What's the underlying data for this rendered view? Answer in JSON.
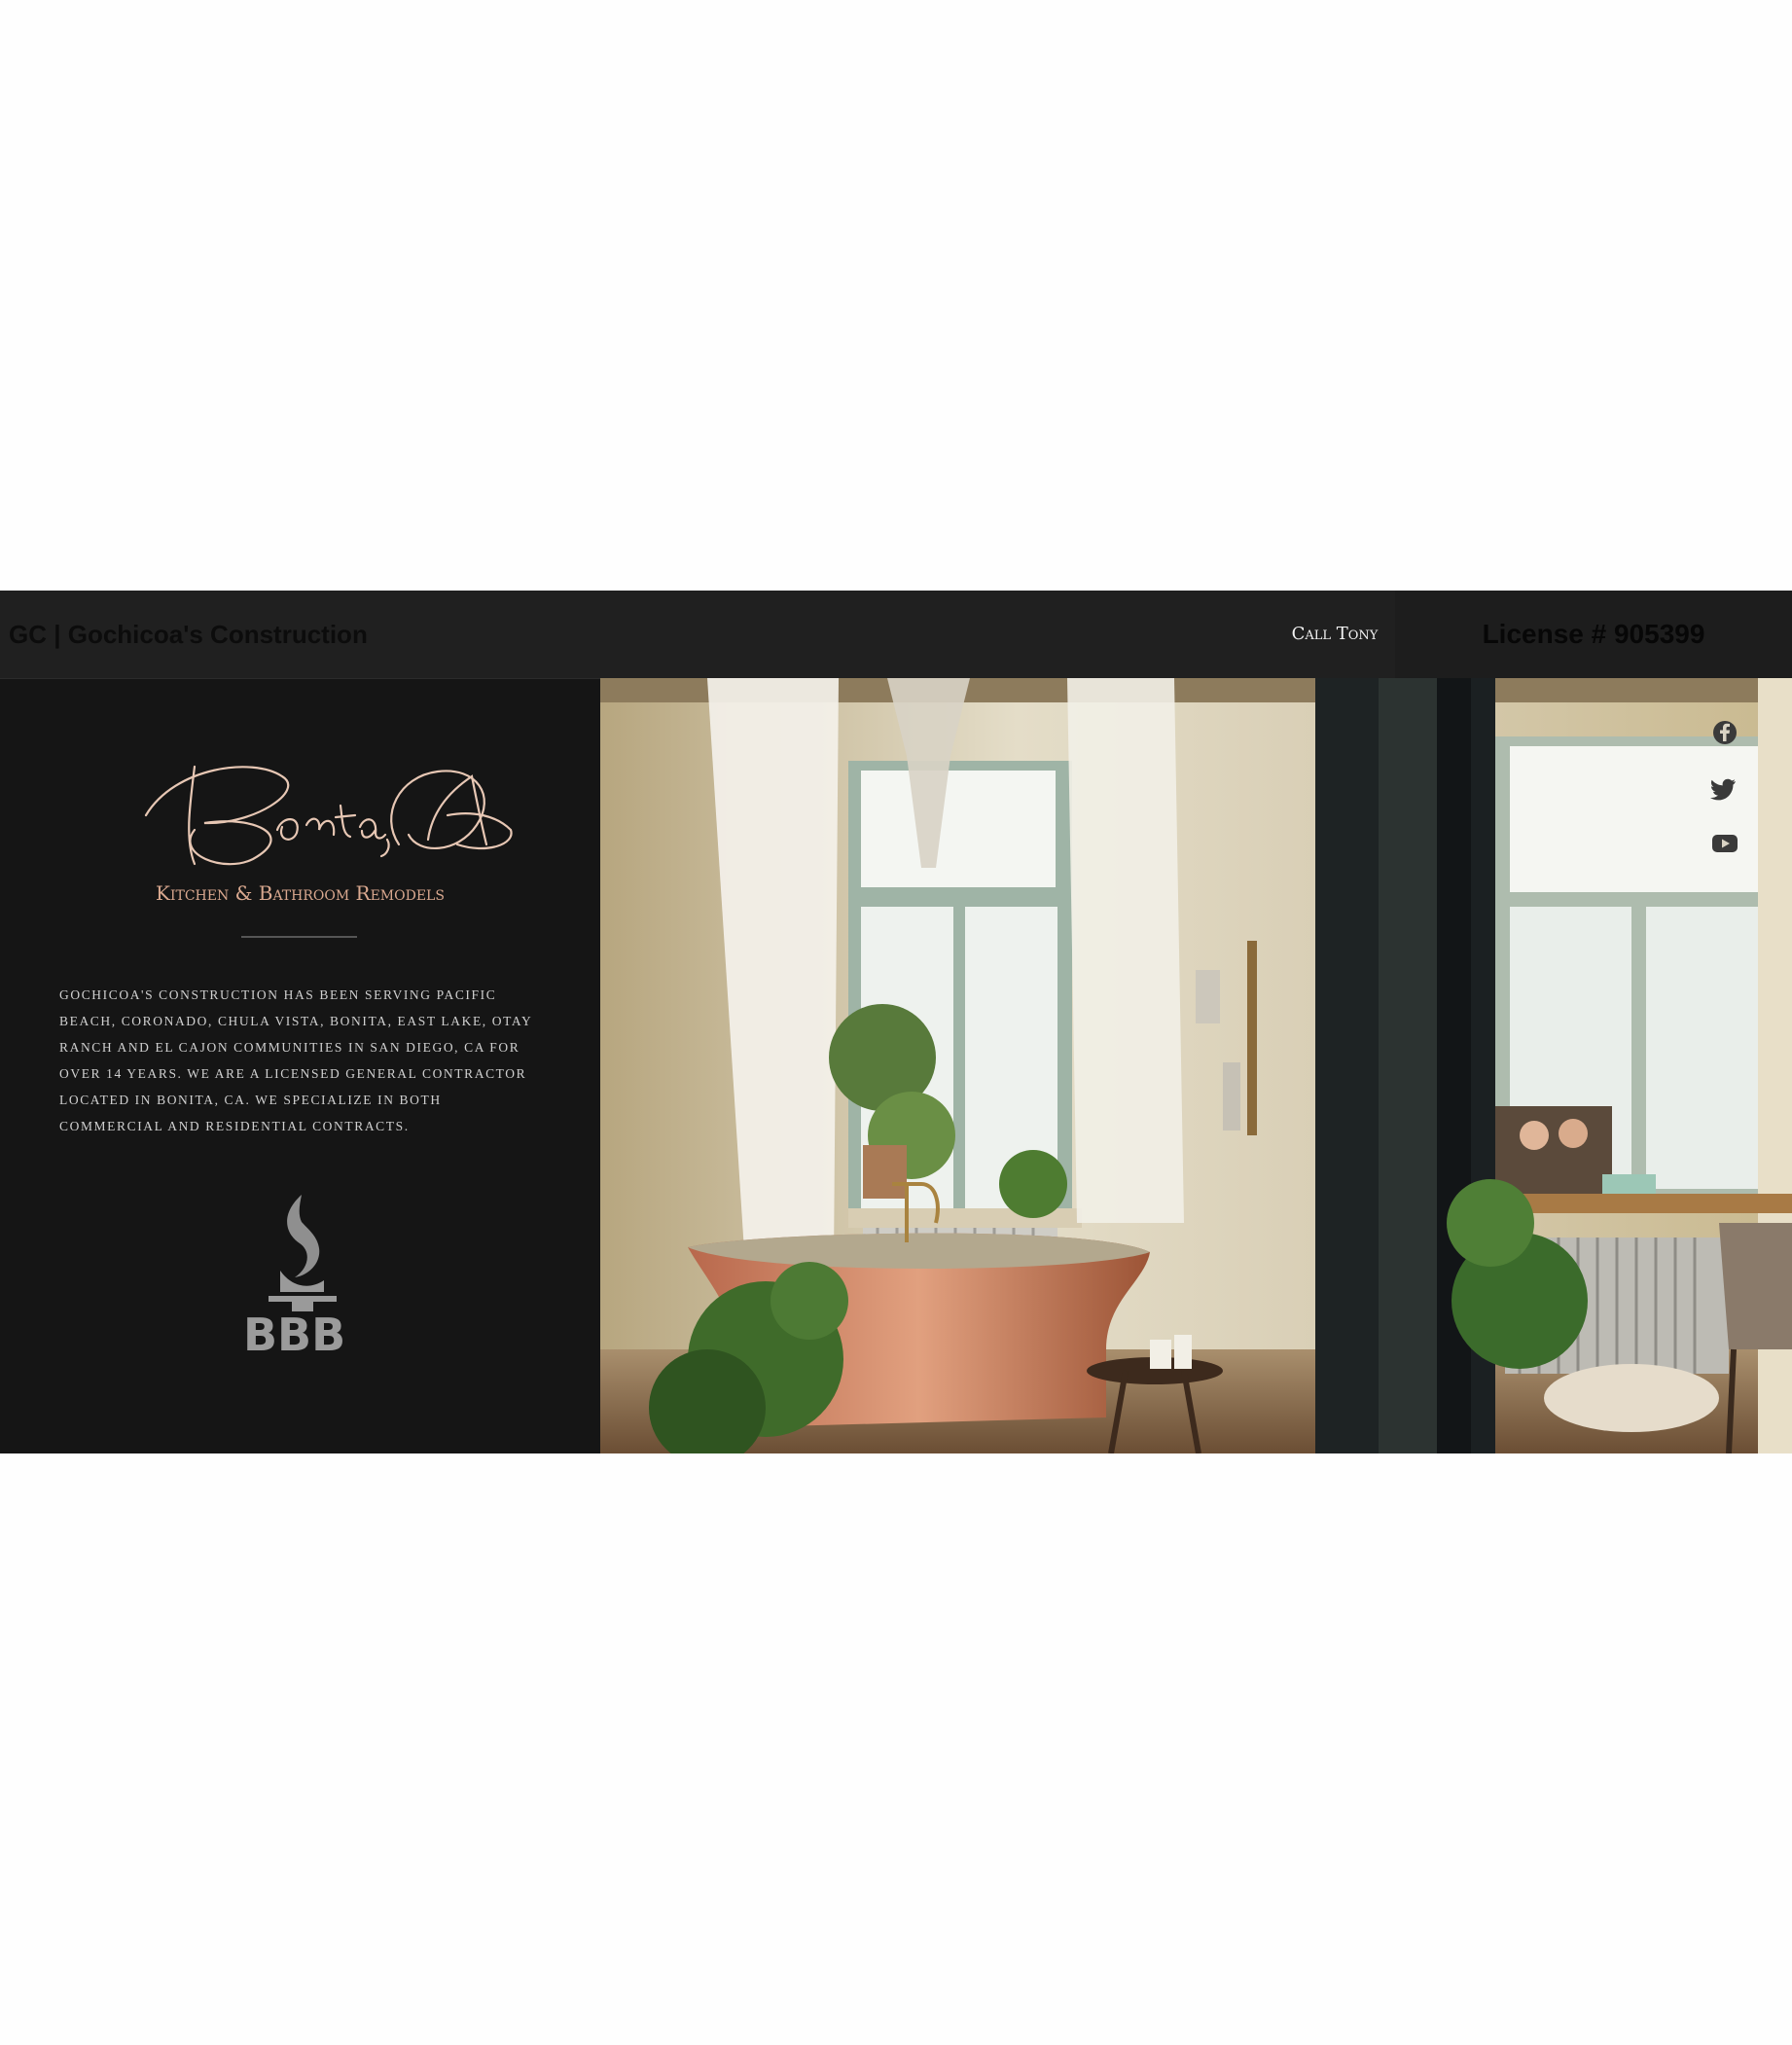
{
  "header": {
    "brand": "GC | Gochicoa's Construction",
    "call_label": "Call Tony",
    "license": "License # 905399"
  },
  "hero": {
    "logo_script": "Bonita, CA",
    "tagline": "Kitchen & Bathroom Remodels",
    "about": "Gochicoa's Construction has been serving Pacific Beach, Coronado, Chula Vista, Bonita, East Lake, Otay Ranch and El Cajon communities in San Diego, CA for over 14 years. We are a licensed general contractor located in Bonita, CA. We specialize in both commercial and residential contracts.",
    "badge": "BBB"
  },
  "social": [
    {
      "icon": "facebook-icon"
    },
    {
      "icon": "twitter-icon"
    },
    {
      "icon": "youtube-icon"
    }
  ],
  "colors": {
    "header_bg": "#202020",
    "panel_bg": "#151515",
    "accent": "#d9a88f"
  }
}
